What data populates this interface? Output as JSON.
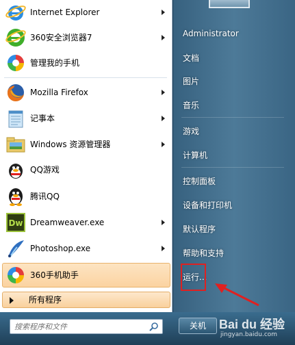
{
  "programs": [
    {
      "label": "Internet Explorer",
      "icon": "internet-explorer-icon",
      "has_arrow": true
    },
    {
      "label": "360安全浏览器7",
      "icon": "360-browser-icon",
      "has_arrow": true
    },
    {
      "label": "管理我的手机",
      "icon": "phone-manager-icon",
      "has_arrow": false
    },
    {
      "label": "Mozilla Firefox",
      "icon": "firefox-icon",
      "has_arrow": true
    },
    {
      "label": "记事本",
      "icon": "notepad-icon",
      "has_arrow": true
    },
    {
      "label": "Windows 资源管理器",
      "icon": "explorer-icon",
      "has_arrow": true
    },
    {
      "label": "QQ游戏",
      "icon": "qq-game-icon",
      "has_arrow": false
    },
    {
      "label": "腾讯QQ",
      "icon": "qq-icon",
      "has_arrow": false
    },
    {
      "label": "Dreamweaver.exe",
      "icon": "dreamweaver-icon",
      "has_arrow": true
    },
    {
      "label": "Photoshop.exe",
      "icon": "photoshop-icon",
      "has_arrow": true
    },
    {
      "label": "360手机助手",
      "icon": "360-phone-assistant-icon",
      "has_arrow": false,
      "highlighted": true
    }
  ],
  "all_programs_label": "所有程序",
  "search": {
    "placeholder": "搜索程序和文件"
  },
  "right_menu": [
    {
      "label": "Administrator"
    },
    {
      "label": "文档"
    },
    {
      "label": "图片"
    },
    {
      "label": "音乐"
    },
    {
      "label": "游戏"
    },
    {
      "label": "计算机"
    },
    {
      "label": "控制面板"
    },
    {
      "label": "设备和打印机"
    },
    {
      "label": "默认程序"
    },
    {
      "label": "帮助和支持"
    },
    {
      "label": "运行..."
    }
  ],
  "shutdown_label": "关机",
  "watermark": {
    "main": "Bai du 经验",
    "url": "jingyan.baidu.com"
  },
  "colors": {
    "highlight": "#fbd3a1",
    "annotation": "#e02020",
    "right_pane": "#4d7a98"
  }
}
